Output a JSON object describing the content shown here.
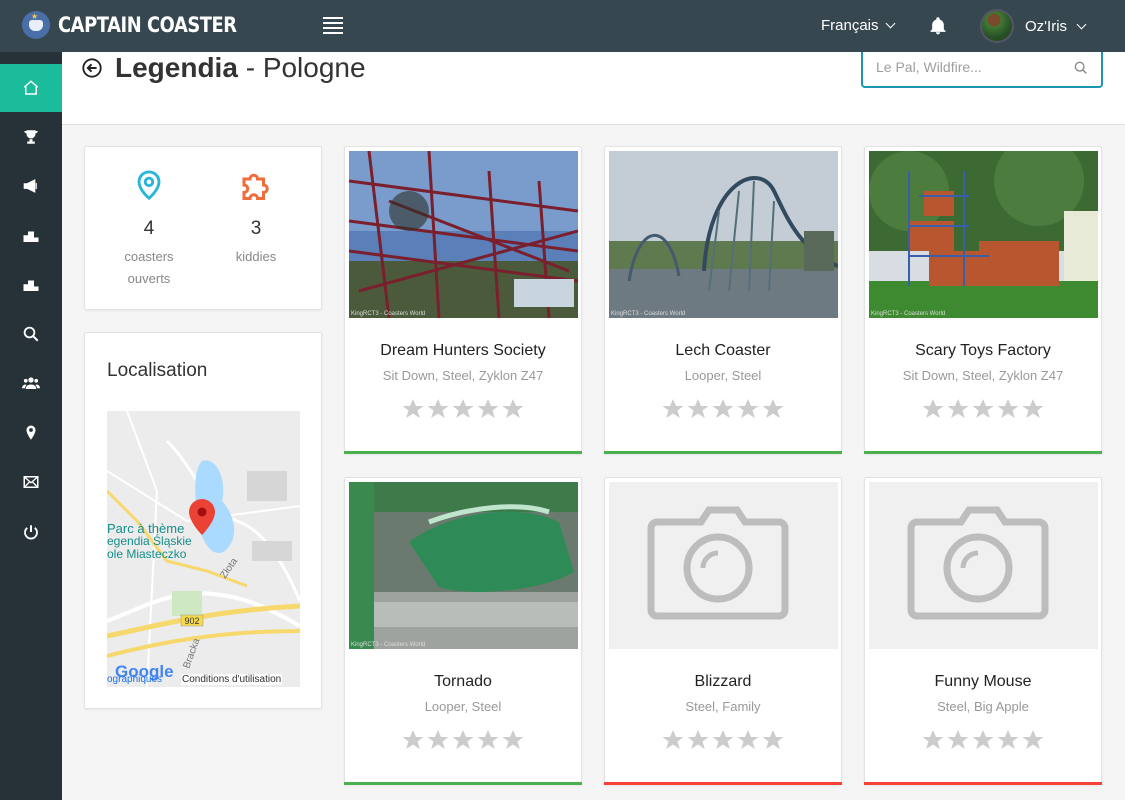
{
  "app": {
    "logo_text": "CAPTAIN COASTER"
  },
  "topbar": {
    "language": "Français",
    "user_name": "Oz'Iris"
  },
  "page": {
    "park": "Legendia",
    "separator": " - ",
    "country": "Pologne"
  },
  "search": {
    "placeholder": "Le Pal, Wildfire..."
  },
  "stats": [
    {
      "value": "4",
      "label": "coasters ouverts",
      "icon": "location-pin-icon",
      "color": "#29b6d8"
    },
    {
      "value": "3",
      "label": "kiddies",
      "icon": "puzzle-piece-icon",
      "color": "#f26b3a"
    }
  ],
  "location": {
    "title": "Localisation",
    "map_label": "Parc à thème Legendia Śląskie Wesołe Miasteczko",
    "map_label_lines": [
      "Parc à thème",
      "egendia Śląskie",
      "ole Miasteczko"
    ],
    "street_label": "Złota",
    "road_number": "902",
    "street_label_2": "Bracka",
    "google": "Google",
    "topo_link": "ographiques",
    "terms": "Conditions d'utilisation"
  },
  "coasters": [
    {
      "name": "Dream Hunters Society",
      "tags": "Sit Down, Steel, Zyklon Z47",
      "photo": "photo",
      "credit": "KingRCT3 - Coasters World",
      "status_color": "#4caf50",
      "rating": 0
    },
    {
      "name": "Lech Coaster",
      "tags": "Looper, Steel",
      "photo": "photo",
      "credit": "KingRCT3 - Coasters World",
      "status_color": "#4caf50",
      "rating": 0
    },
    {
      "name": "Scary Toys Factory",
      "tags": "Sit Down, Steel, Zyklon Z47",
      "photo": "photo",
      "credit": "KingRCT3 - Coasters World",
      "status_color": "#4caf50",
      "rating": 0
    },
    {
      "name": "Tornado",
      "tags": "Looper, Steel",
      "photo": "photo",
      "credit": "KingRCT3 - Coasters World",
      "status_color": "#4caf50",
      "rating": 0
    },
    {
      "name": "Blizzard",
      "tags": "Steel, Family",
      "photo": "camera-placeholder-icon",
      "credit": "",
      "status_color": "#f44336",
      "rating": 0
    },
    {
      "name": "Funny Mouse",
      "tags": "Steel, Big Apple",
      "photo": "camera-placeholder-icon",
      "credit": "",
      "status_color": "#f44336",
      "rating": 0
    }
  ],
  "sidebar": {
    "items": [
      {
        "icon": "home-icon",
        "active": true
      },
      {
        "icon": "trophy-icon",
        "active": false
      },
      {
        "icon": "megaphone-icon",
        "active": false
      },
      {
        "icon": "podium-icon",
        "active": false
      },
      {
        "icon": "podium-icon",
        "active": false
      },
      {
        "icon": "search-icon",
        "active": false
      },
      {
        "icon": "users-icon",
        "active": false
      },
      {
        "icon": "map-pin-icon",
        "active": false
      },
      {
        "icon": "envelope-icon",
        "active": false
      },
      {
        "icon": "power-icon",
        "active": false
      }
    ]
  },
  "colors": {
    "accent": "#1abc9c",
    "topbar": "#37474f",
    "sidebar": "#263238",
    "search_border": "#1c96b5",
    "open": "#4caf50",
    "closed": "#f44336"
  }
}
